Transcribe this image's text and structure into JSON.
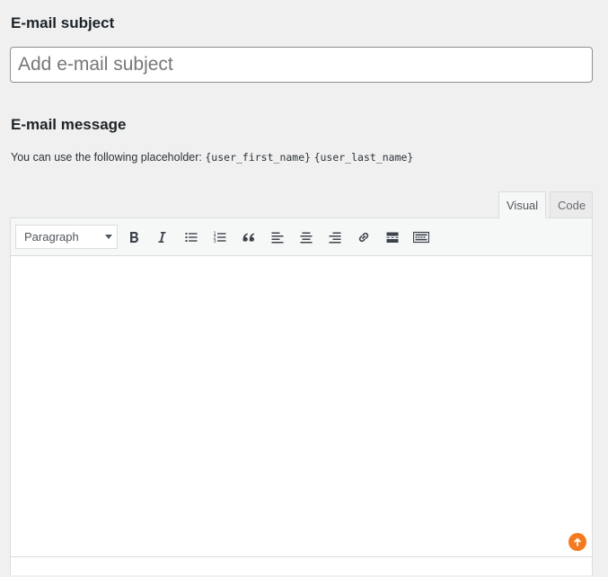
{
  "subject": {
    "title": "E-mail subject",
    "placeholder": "Add e-mail subject",
    "value": ""
  },
  "message": {
    "title": "E-mail message",
    "hint_text": "You can use the following placeholder:",
    "placeholders": [
      "{user_first_name}",
      "{user_last_name}"
    ]
  },
  "editor": {
    "tabs": [
      {
        "label": "Visual",
        "active": true
      },
      {
        "label": "Code",
        "active": false
      }
    ],
    "format_select": "Paragraph",
    "toolbar_icons": [
      "bold-icon",
      "italic-icon",
      "bulleted-list-icon",
      "numbered-list-icon",
      "blockquote-icon",
      "align-left-icon",
      "align-center-icon",
      "align-right-icon",
      "link-icon",
      "read-more-icon",
      "toolbar-toggle-icon"
    ],
    "badge_color": "#f37a20"
  }
}
